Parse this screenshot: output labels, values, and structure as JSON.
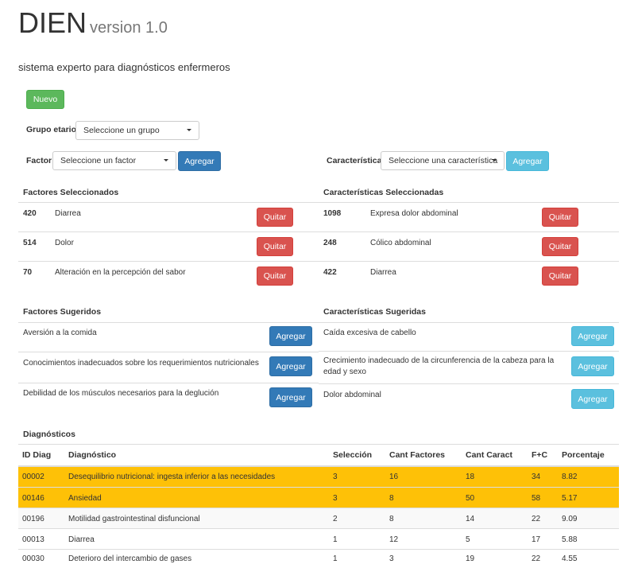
{
  "header": {
    "title": "DIEN",
    "version": "version 1.0",
    "subtitle": "sistema experto para diagnósticos enfermeros"
  },
  "buttons": {
    "nuevo": "Nuevo",
    "agregar": "Agregar",
    "quitar": "Quitar"
  },
  "grupo": {
    "label": "Grupo etario",
    "value": "Seleccione un grupo"
  },
  "factor": {
    "label": "Factor",
    "value": "Seleccione un factor"
  },
  "caracteristica": {
    "label": "Característica",
    "value": "Seleccione una característica"
  },
  "factores_seleccionados": {
    "title": "Factores Seleccionados",
    "items": [
      {
        "id": "420",
        "name": "Diarrea"
      },
      {
        "id": "514",
        "name": "Dolor"
      },
      {
        "id": "70",
        "name": "Alteración en la percepción del sabor"
      }
    ]
  },
  "caracteristicas_seleccionadas": {
    "title": "Características Seleccionadas",
    "items": [
      {
        "id": "1098",
        "name": "Expresa dolor abdominal"
      },
      {
        "id": "248",
        "name": "Cólico abdominal"
      },
      {
        "id": "422",
        "name": "Diarrea"
      }
    ]
  },
  "factores_sugeridos": {
    "title": "Factores Sugeridos",
    "items": [
      "Aversión a la comida",
      "Conocimientos inadecuados sobre los requerimientos nutricionales",
      "Debilidad de los músculos necesarios para la deglución"
    ]
  },
  "caracteristicas_sugeridas": {
    "title": "Características Sugeridas",
    "items": [
      "Caída excesiva de cabello",
      "Crecimiento inadecuado de la circunferencia de la cabeza para la edad y sexo",
      "Dolor abdominal"
    ]
  },
  "diagnosticos": {
    "title": "Diagnósticos",
    "columns": [
      "ID Diag",
      "Diagnóstico",
      "Selección",
      "Cant Factores",
      "Cant Caract",
      "F+C",
      "Porcentaje"
    ],
    "rows": [
      [
        "00002",
        "Desequilibrio nutricional: ingesta inferior a las necesidades",
        "3",
        "16",
        "18",
        "34",
        "8.82"
      ],
      [
        "00146",
        "Ansiedad",
        "3",
        "8",
        "50",
        "58",
        "5.17"
      ],
      [
        "00196",
        "Motilidad gastrointestinal disfuncional",
        "2",
        "8",
        "14",
        "22",
        "9.09"
      ],
      [
        "00013",
        "Diarrea",
        "1",
        "12",
        "5",
        "17",
        "5.88"
      ],
      [
        "00030",
        "Deterioro del intercambio de gases",
        "1",
        "3",
        "19",
        "22",
        "4.55"
      ]
    ],
    "highlight_color": "#fec107"
  }
}
